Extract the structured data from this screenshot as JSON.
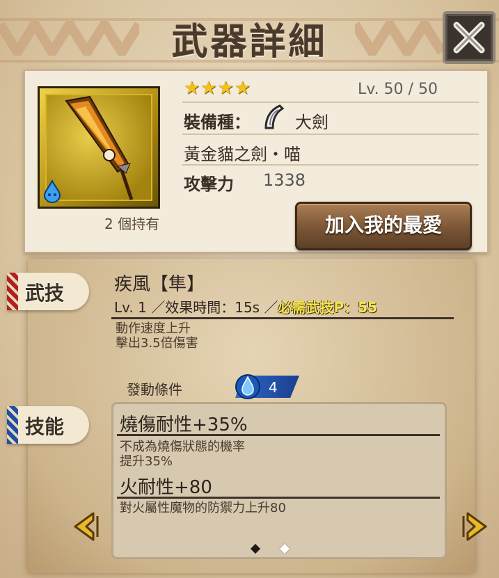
{
  "header": {
    "title": "武器詳細"
  },
  "weapon": {
    "stars": "★★★★",
    "level": "Lv.  50  /  50",
    "equip_label": "裝備種：",
    "equip_type": "大劍",
    "name": "黃金貓之劍・喵",
    "attack_label": "攻擊力",
    "attack_value": "1338",
    "owned": "2 個持有",
    "favorite_button": "加入我的最愛"
  },
  "move": {
    "tag": "武技",
    "name": "疾風【隼】",
    "level": "Lv.  1",
    "duration": "／效果時間：15s",
    "required_prefix": "／",
    "required": "必需武技P：55",
    "desc_line1": "動作速度上升",
    "desc_line2": "擊出3.5倍傷害",
    "condition_label": "發動條件",
    "condition_count": "4"
  },
  "skills": {
    "tag": "技能",
    "items": [
      {
        "name": "燒傷耐性+35%",
        "desc_line1": "不成為燒傷狀態的機率",
        "desc_line2": "提升35%"
      },
      {
        "name": "火耐性+80",
        "desc_line1": "對火屬性魔物的防禦力上升80",
        "desc_line2": ""
      }
    ]
  },
  "pager": {
    "total": 2,
    "current": 1
  },
  "colors": {
    "star": "#f3c21a",
    "highlight": "#f7e54a",
    "condition_badge": "#2f68c8",
    "arrow": "#e7b92c"
  }
}
